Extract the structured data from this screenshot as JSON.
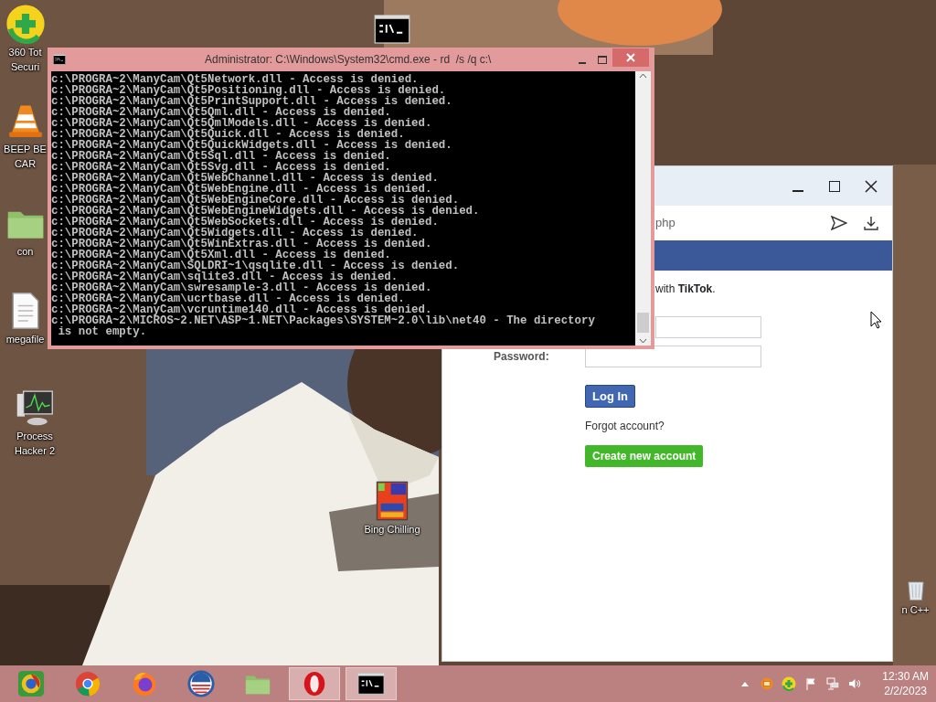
{
  "desktop": {
    "icons": [
      {
        "kind": "plus-badge",
        "label": [
          "360 Tot",
          "Securi"
        ]
      },
      {
        "kind": "cone",
        "label": [
          "BEEP BE",
          "CAR"
        ]
      },
      {
        "kind": "folder",
        "label": [
          "con"
        ]
      },
      {
        "kind": "document",
        "label": [
          "megafile"
        ]
      },
      {
        "kind": "monitor",
        "label": [
          "Process",
          "Hacker 2"
        ]
      },
      {
        "kind": "card",
        "label": [
          "Bing Chilling"
        ]
      },
      {
        "kind": "bin",
        "label": [
          "n C++"
        ]
      },
      {
        "kind": "console"
      }
    ]
  },
  "browser": {
    "address_fragment": "php",
    "notice": "with **TikTok**.",
    "password_label": "Password:",
    "login_button": "Log In",
    "forgot_link": "Forgot account?",
    "create_button": "Create new account"
  },
  "console_window": {
    "title": "Administrator: C:\\Windows\\System32\\cmd.exe - rd  /s /q c:\\",
    "lines": [
      "c:\\PROGRA~2\\ManyCam\\Qt5Network.dll - Access is denied.",
      "c:\\PROGRA~2\\ManyCam\\Qt5Positioning.dll - Access is denied.",
      "c:\\PROGRA~2\\ManyCam\\Qt5PrintSupport.dll - Access is denied.",
      "c:\\PROGRA~2\\ManyCam\\Qt5Qml.dll - Access is denied.",
      "c:\\PROGRA~2\\ManyCam\\Qt5QmlModels.dll - Access is denied.",
      "c:\\PROGRA~2\\ManyCam\\Qt5Quick.dll - Access is denied.",
      "c:\\PROGRA~2\\ManyCam\\Qt5QuickWidgets.dll - Access is denied.",
      "c:\\PROGRA~2\\ManyCam\\Qt5Sql.dll - Access is denied.",
      "c:\\PROGRA~2\\ManyCam\\Qt5Svg.dll - Access is denied.",
      "c:\\PROGRA~2\\ManyCam\\Qt5WebChannel.dll - Access is denied.",
      "c:\\PROGRA~2\\ManyCam\\Qt5WebEngine.dll - Access is denied.",
      "c:\\PROGRA~2\\ManyCam\\Qt5WebEngineCore.dll - Access is denied.",
      "c:\\PROGRA~2\\ManyCam\\Qt5WebEngineWidgets.dll - Access is denied.",
      "c:\\PROGRA~2\\ManyCam\\Qt5WebSockets.dll - Access is denied.",
      "c:\\PROGRA~2\\ManyCam\\Qt5Widgets.dll - Access is denied.",
      "c:\\PROGRA~2\\ManyCam\\Qt5WinExtras.dll - Access is denied.",
      "c:\\PROGRA~2\\ManyCam\\Qt5Xml.dll - Access is denied.",
      "c:\\PROGRA~2\\ManyCam\\SQLDRI~1\\qsqlite.dll - Access is denied.",
      "c:\\PROGRA~2\\ManyCam\\sqlite3.dll - Access is denied.",
      "c:\\PROGRA~2\\ManyCam\\swresample-3.dll - Access is denied.",
      "c:\\PROGRA~2\\ManyCam\\ucrtbase.dll - Access is denied.",
      "c:\\PROGRA~2\\ManyCam\\vcruntime140.dll - Access is denied.",
      "c:\\PROGRA~2\\MICROS~2.NET\\ASP~1.NET\\Packages\\SYSTEM~2.0\\lib\\net40 - The directory",
      " is not empty."
    ]
  },
  "taskbar": {
    "apps": [
      {
        "kind": "swirl",
        "running": false
      },
      {
        "kind": "tricolor",
        "running": false
      },
      {
        "kind": "flame",
        "running": false
      },
      {
        "kind": "stripes",
        "running": false
      },
      {
        "kind": "folder",
        "running": false
      },
      {
        "kind": "ring",
        "running": true
      },
      {
        "kind": "console",
        "running": true
      }
    ],
    "tray": [
      {
        "kind": "caret"
      },
      {
        "kind": "orange"
      },
      {
        "kind": "plus-badge"
      },
      {
        "kind": "flag"
      },
      {
        "kind": "network"
      },
      {
        "kind": "speaker"
      }
    ],
    "time": "12:30 AM",
    "date": "2/2/2023"
  }
}
